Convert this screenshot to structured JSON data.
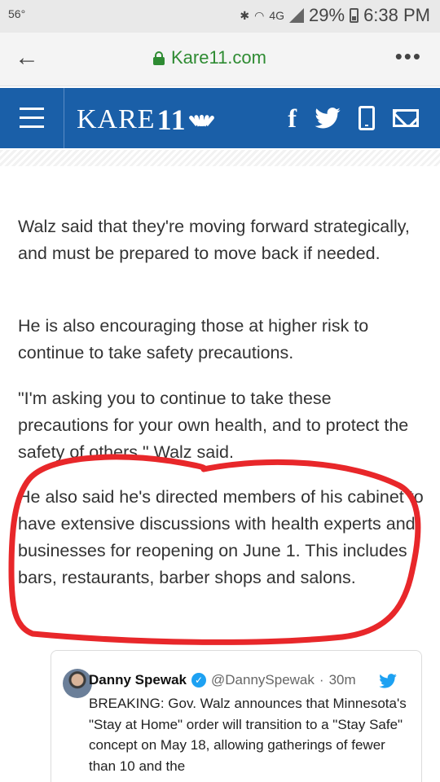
{
  "status_bar": {
    "temperature": "56°",
    "network": "4G",
    "battery": "29%",
    "time": "6:38 PM"
  },
  "browser": {
    "url": "Kare11.com"
  },
  "site": {
    "logo_text": "KARE",
    "logo_number": "11",
    "social_icons": [
      "facebook-icon",
      "twitter-icon",
      "mobile-icon",
      "mail-icon"
    ],
    "brand_color": "#1a5fa8"
  },
  "article": {
    "paragraphs": [
      "Walz said that they're moving forward strategically, and must be prepared to move back if needed.",
      "He is also encouraging those at higher risk to continue to take safety precautions.",
      "\"I'm asking you to continue to take these precautions for your own health, and to protect the safety of others,\" Walz said.",
      "He also said he's directed members of his cabinet to have extensive discussions with health experts and businesses for reopening on June 1. This includes bars, restaurants, barber shops and salons."
    ]
  },
  "tweet": {
    "name": "Danny Spewak",
    "handle": "@DannySpewak",
    "time": "30m",
    "text": "BREAKING: Gov. Walz announces that Minnesota's \"Stay at Home\" order will transition to a \"Stay Safe\" concept on May 18, allowing gatherings of fewer than 10 and the"
  },
  "annotation_color": "#e8272a"
}
